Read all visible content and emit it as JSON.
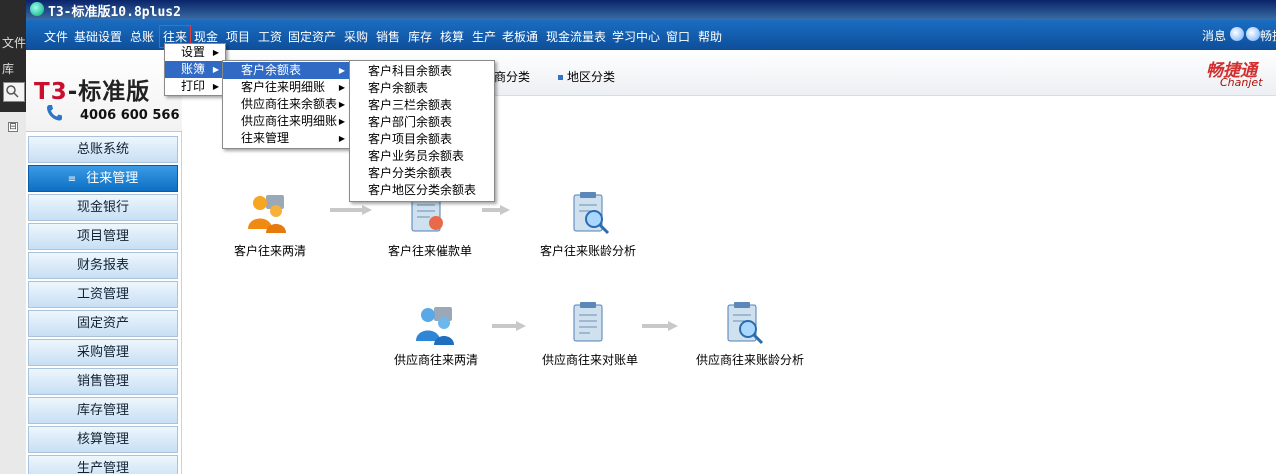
{
  "background_app": {
    "menu_label": "文件",
    "side_label": "库",
    "expander": "⊟"
  },
  "window": {
    "title": "T3-标准版10.8plus2"
  },
  "menubar": {
    "items": [
      "文件",
      "基础设置",
      "总账",
      "往来",
      "现金",
      "项目",
      "工资",
      "固定资产",
      "采购",
      "销售",
      "库存",
      "核算",
      "生产",
      "老板通",
      "现金流量表",
      "学习中心",
      "窗口",
      "帮助"
    ],
    "active_index": 3,
    "message_label": "消息",
    "help_label": "畅捷"
  },
  "logo": {
    "brand_t3": "T3",
    "brand_rest": "-标准版",
    "phone": "4006 600 566"
  },
  "sidebar": {
    "items": [
      "总账系统",
      "往来管理",
      "现金银行",
      "项目管理",
      "财务报表",
      "工资管理",
      "固定资产",
      "采购管理",
      "销售管理",
      "库存管理",
      "核算管理",
      "生产管理"
    ],
    "active_index": 1,
    "active_marker": "≡"
  },
  "tabs": {
    "items": [
      "应商分类",
      "地区分类"
    ]
  },
  "brand_corner": {
    "cn": "畅捷通",
    "en": "Chanjet"
  },
  "flow": {
    "customer": [
      "客户往来两清",
      "客户往来催款单",
      "客户往来账龄分析"
    ],
    "supplier": [
      "供应商往来两清",
      "供应商往来对账单",
      "供应商往来账龄分析"
    ]
  },
  "menu_level1": {
    "items": [
      "设置",
      "账簿",
      "打印"
    ],
    "selected_index": 1
  },
  "menu_level2": {
    "items": [
      "客户余额表",
      "客户往来明细账",
      "供应商往来余额表",
      "供应商往来明细账",
      "往来管理"
    ],
    "selected_index": 0
  },
  "menu_level3": {
    "items": [
      "客户科目余额表",
      "客户余额表",
      "客户三栏余额表",
      "客户部门余额表",
      "客户项目余额表",
      "客户业务员余额表",
      "客户分类余额表",
      "客户地区分类余额表"
    ]
  },
  "colors": {
    "menubar": "#0e4f9a",
    "menu_selected": "#316ac5",
    "nav_active": "#0d6fc2",
    "brand_red": "#c8102e"
  }
}
